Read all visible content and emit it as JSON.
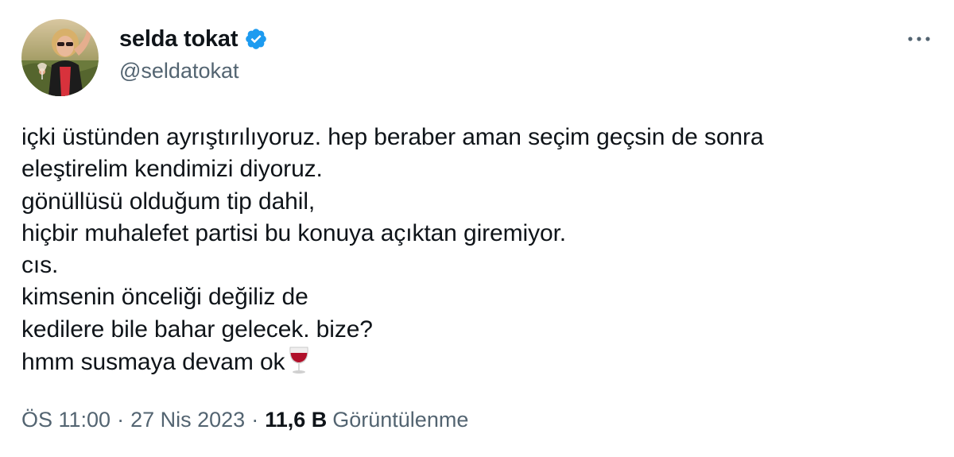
{
  "tweet": {
    "author": {
      "display_name": "selda tokat",
      "handle": "@seldatokat",
      "verified": true,
      "verified_color": "#1d9bf0"
    },
    "more_icon": "more-horizontal-icon",
    "lines": [
      "içki üstünden ayrıştırılıyoruz. hep beraber aman seçim geçsin de sonra",
      "eleştirelim kendimizi diyoruz.",
      "gönüllüsü olduğum tip dahil,",
      "hiçbir muhalefet partisi bu konuya açıktan giremiyor.",
      "cıs.",
      "kimsenin önceliği değiliz de",
      "kedilere bile bahar gelecek. bize?",
      "hmm susmaya devam ok"
    ],
    "trailing_emoji": "wine-glass-emoji",
    "meta": {
      "time": "ÖS 11:00",
      "separator": "·",
      "date": "27 Nis 2023",
      "views_count": "11,6 B",
      "views_label": "Görüntülenme"
    }
  }
}
